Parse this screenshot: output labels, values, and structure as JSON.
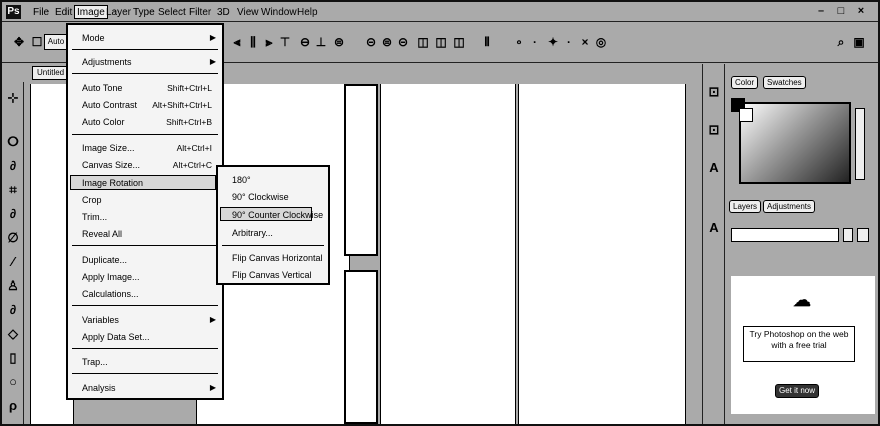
{
  "menubar": {
    "items": [
      "File",
      "Edit",
      "Image",
      "Layer",
      "Type",
      "Select",
      "Filter",
      "3D",
      "View",
      "Window",
      "Help"
    ],
    "active_index": 2,
    "window_controls": [
      "–",
      "□",
      "×"
    ]
  },
  "optbar": {
    "auto_label": "Auto",
    "icons": [
      "move-arrows-icon",
      "gear-icon",
      "align-icons",
      "distribute-icons",
      "3d-mode-icons",
      "search-icon",
      "workspace-icon"
    ]
  },
  "doc_tab": {
    "label": "Untitled"
  },
  "image_menu": {
    "items": [
      {
        "label": "Mode",
        "shortcut": "",
        "submenu": true
      },
      {
        "label": "Adjustments",
        "shortcut": "",
        "submenu": true
      },
      {
        "label": "Auto Tone",
        "shortcut": "Shift+Ctrl+L",
        "submenu": false
      },
      {
        "label": "Auto Contrast",
        "shortcut": "Alt+Shift+Ctrl+L",
        "submenu": false
      },
      {
        "label": "Auto Color",
        "shortcut": "Shift+Ctrl+B",
        "submenu": false
      },
      {
        "label": "Image Size...",
        "shortcut": "Alt+Ctrl+I",
        "submenu": false
      },
      {
        "label": "Canvas Size...",
        "shortcut": "Alt+Ctrl+C",
        "submenu": false
      },
      {
        "label": "Image Rotation",
        "shortcut": "",
        "submenu": true
      },
      {
        "label": "Crop",
        "shortcut": "",
        "submenu": false
      },
      {
        "label": "Trim...",
        "shortcut": "",
        "submenu": false
      },
      {
        "label": "Reveal All",
        "shortcut": "",
        "submenu": false
      },
      {
        "label": "Duplicate...",
        "shortcut": "",
        "submenu": false
      },
      {
        "label": "Apply Image...",
        "shortcut": "",
        "submenu": false
      },
      {
        "label": "Calculations...",
        "shortcut": "",
        "submenu": false
      },
      {
        "label": "Variables",
        "shortcut": "",
        "submenu": true
      },
      {
        "label": "Apply Data Set...",
        "shortcut": "",
        "submenu": false
      },
      {
        "label": "Trap...",
        "shortcut": "",
        "submenu": false
      },
      {
        "label": "Analysis",
        "shortcut": "",
        "submenu": true
      }
    ],
    "highlighted_index": 7
  },
  "rotation_submenu": {
    "items": [
      "180°",
      "90° Clockwise",
      "90° Counter Clockwise",
      "Arbitrary...",
      "Flip Canvas Horizontal",
      "Flip Canvas Vertical"
    ],
    "highlighted_index": 2
  },
  "right_panel": {
    "tabs_top": [
      "Color",
      "Swatches"
    ],
    "tabs_mid": [
      "Layers",
      "Adjustments"
    ],
    "promo_text": "Try Photoshop on the web with a free trial",
    "promo_button": "Get it now"
  }
}
